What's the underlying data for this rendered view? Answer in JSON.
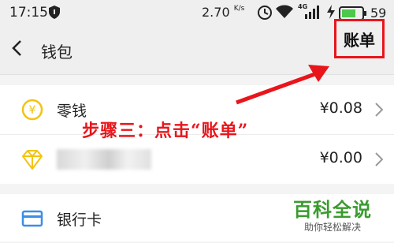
{
  "status_bar": {
    "time": "17:15",
    "speed": "2.70",
    "speed_unit": "K/s",
    "network": "4G",
    "battery": "59"
  },
  "nav": {
    "title": "钱包",
    "bill_label": "账单"
  },
  "rows": [
    {
      "label": "零钱",
      "value": "¥0.08",
      "icon": "yen-coin-icon"
    },
    {
      "label": "",
      "value": "¥0.00",
      "icon": "diamond-icon"
    },
    {
      "label": "银行卡",
      "value": "",
      "icon": "bank-card-icon"
    }
  ],
  "annotation": {
    "text": "步骤三：点击“账单”"
  },
  "watermark": {
    "title": "百科全说",
    "subtitle": "助你轻松解决"
  },
  "colors": {
    "accent_red": "#e8151b",
    "coin_yellow": "#f2c40f",
    "card_blue": "#3b8ee8",
    "watermark_green": "#3a9b2f"
  }
}
